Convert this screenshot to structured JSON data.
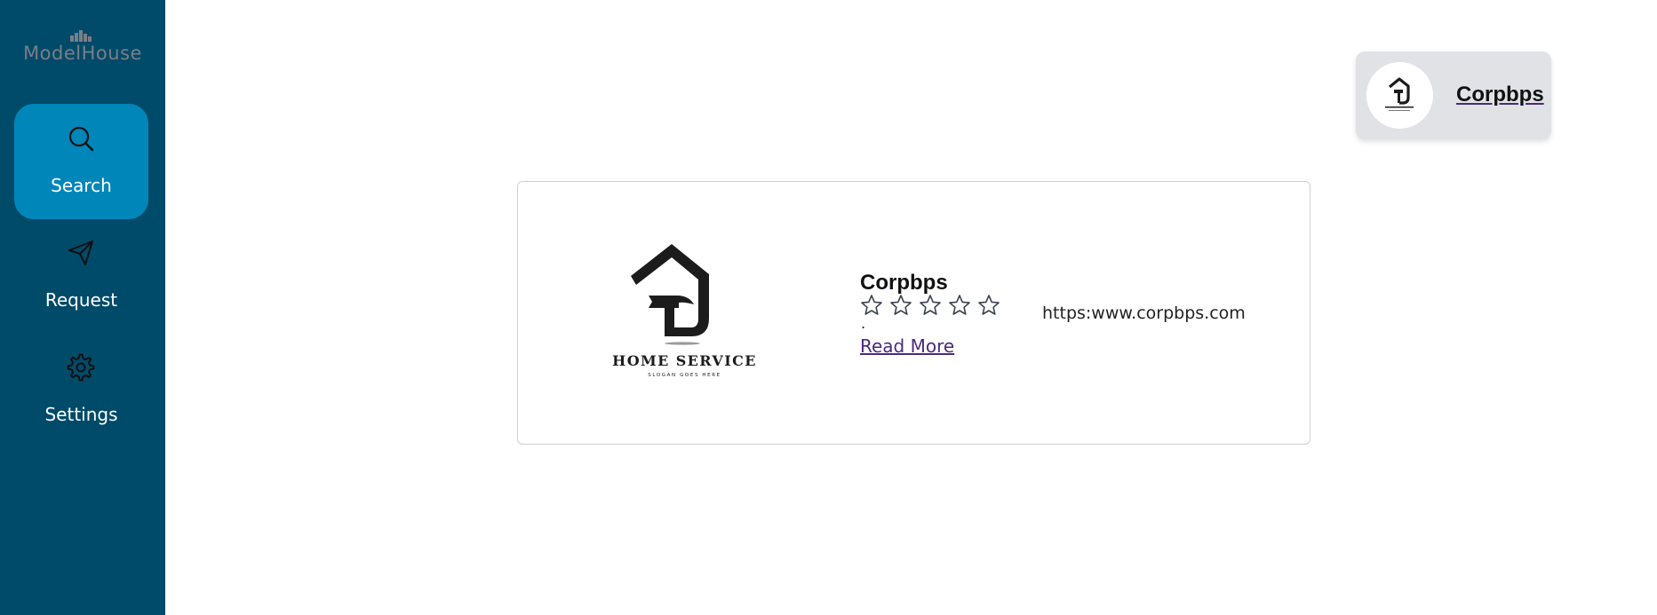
{
  "brand": {
    "name": "ModelHouse"
  },
  "sidebar": {
    "items": [
      {
        "label": "Search",
        "icon": "search-icon",
        "active": true
      },
      {
        "label": "Request",
        "icon": "send-icon",
        "active": false
      },
      {
        "label": "Settings",
        "icon": "gear-icon",
        "active": false
      }
    ]
  },
  "profile": {
    "name": "Corpbps"
  },
  "card": {
    "logo_title": "HOME SERVICE",
    "logo_slogan": "SLOGAN GOES HERE",
    "name": "Corpbps",
    "rating": 0,
    "max_rating": 5,
    "description": ".",
    "read_more": "Read More",
    "url": "https:www.corpbps.com"
  },
  "colors": {
    "sidebar_bg": "#004a6a",
    "active_nav_bg": "#0086b9",
    "link_purple": "#4b2a7a",
    "chip_bg": "#e0e2e6"
  }
}
